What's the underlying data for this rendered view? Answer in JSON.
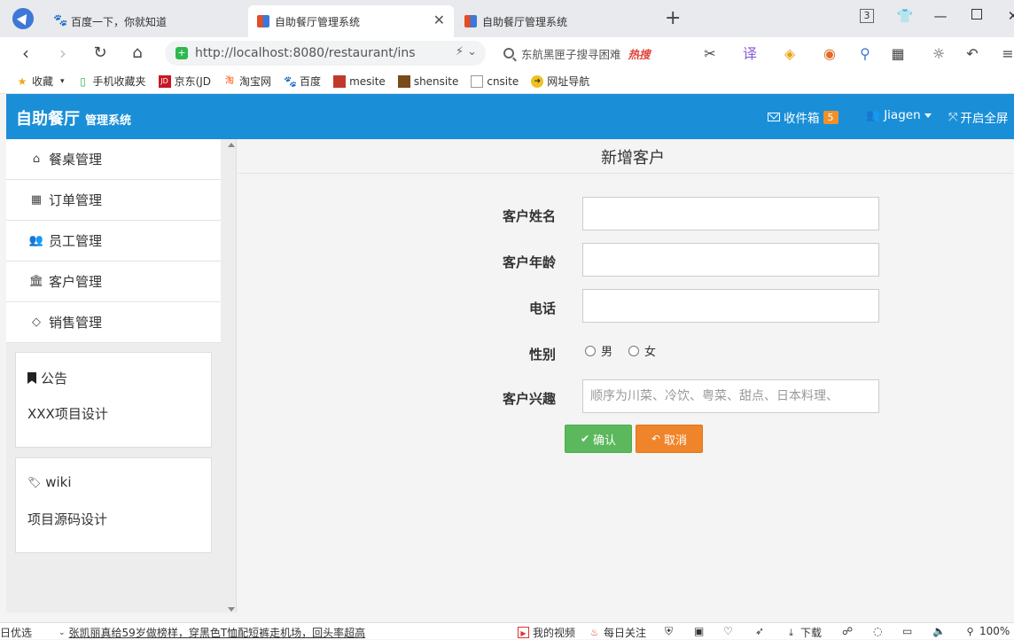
{
  "browser": {
    "tabs": [
      {
        "title": "百度一下，你就知道",
        "active": false
      },
      {
        "title": "自助餐厅管理系统",
        "active": true
      },
      {
        "title": "自助餐厅管理系统",
        "active": false
      }
    ],
    "new_tab": "+",
    "window": {
      "restore": "3",
      "minimize": "—",
      "close": "✕"
    },
    "url": "http://localhost:8080/restaurant/ins",
    "search_text": "东航黑匣子搜寻困难",
    "search_hot": "热搜",
    "bookmarks": [
      "收藏",
      "手机收藏夹",
      "京东(JD",
      "淘宝网",
      "百度",
      "mesite",
      "shensite",
      "cnsite",
      "网址导航"
    ]
  },
  "app": {
    "brand": "自助餐厅",
    "brand_sub": "管理系统",
    "inbox_label": "收件箱",
    "inbox_count": "5",
    "user": "Jiagen",
    "fullscreen": "开启全屏"
  },
  "sidebar": {
    "menu": [
      {
        "label": "餐桌管理",
        "icon": "home-icon"
      },
      {
        "label": "订单管理",
        "icon": "table-icon"
      },
      {
        "label": "员工管理",
        "icon": "users-icon"
      },
      {
        "label": "客户管理",
        "icon": "bank-icon"
      },
      {
        "label": "销售管理",
        "icon": "diamond-icon"
      }
    ],
    "notice": {
      "title": "公告",
      "body": "XXX项目设计"
    },
    "wiki": {
      "title": "wiki",
      "body": "项目源码设计"
    }
  },
  "form": {
    "title": "新增客户",
    "fields": {
      "name_label": "客户姓名",
      "age_label": "客户年龄",
      "phone_label": "电话",
      "gender_label": "性别",
      "gender_male": "男",
      "gender_female": "女",
      "interest_label": "客户兴趣",
      "interest_placeholder": "顺序为川菜、冷饮、粤菜、甜点、日本料理、"
    },
    "confirm": "确认",
    "cancel": "取消"
  },
  "statusbar": {
    "left": "日优选",
    "news": "张凯丽真给59岁做榜样，穿黑色T恤配短裤走机场，回头率超高",
    "video": "我的视频",
    "daily": "每日关注",
    "download": "下载",
    "zoom": "100%"
  }
}
